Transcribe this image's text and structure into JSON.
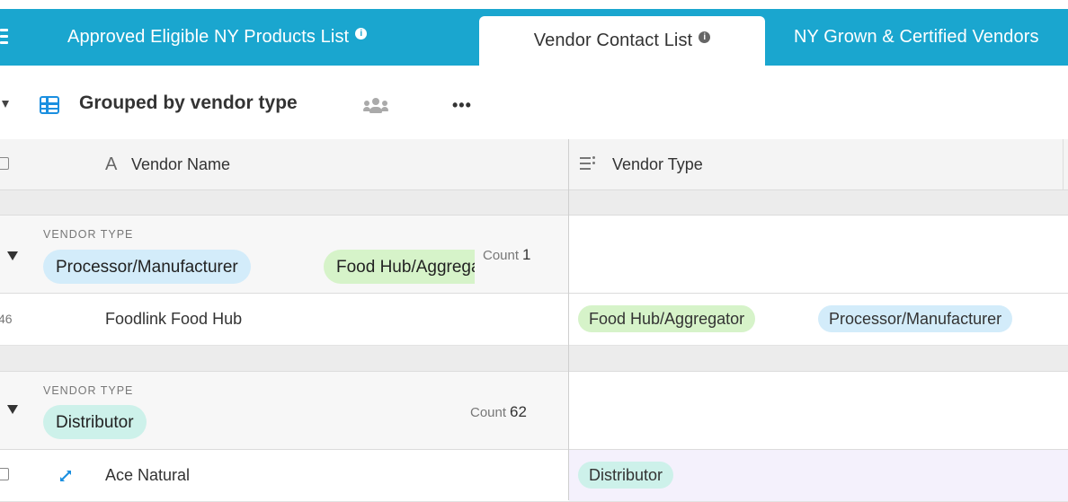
{
  "tabs": [
    {
      "label": "Approved Eligible NY Products List",
      "active": false
    },
    {
      "label": "Vendor Contact List",
      "active": true
    },
    {
      "label": "NY Grown & Certified Vendors",
      "active": false
    }
  ],
  "toolbar": {
    "view_name": "Grouped by vendor type",
    "more_label": "•••"
  },
  "columns": {
    "name": {
      "icon": "A",
      "label": "Vendor Name"
    },
    "type": {
      "label": "Vendor Type"
    }
  },
  "groups": [
    {
      "field_label": "VENDOR TYPE",
      "chips": [
        "Processor/Manufacturer",
        "Food Hub/Aggregator"
      ],
      "count_label": "Count",
      "count": "1",
      "rows": [
        {
          "number": "46",
          "name": "Foodlink Food Hub",
          "types": [
            "Food Hub/Aggregator",
            "Processor/Manufacturer"
          ]
        }
      ]
    },
    {
      "field_label": "VENDOR TYPE",
      "chips": [
        "Distributor"
      ],
      "count_label": "Count",
      "count": "62",
      "rows": [
        {
          "number": "",
          "name": "Ace Natural",
          "types": [
            "Distributor"
          ]
        }
      ]
    }
  ],
  "colors": {
    "tabbar": "#1aa6cf",
    "chip_blue": "#d3ecfa",
    "chip_green": "#d6f3c9",
    "chip_teal": "#cdf1ea",
    "accent": "#1a8fe0"
  },
  "icons": {
    "menu": "menu-icon",
    "info": "info-icon",
    "grid_view": "grid-view-icon",
    "people": "people-icon",
    "text_field": "text-field-icon",
    "multi_select": "multi-select-field-icon",
    "expand": "expand-record-icon",
    "collapse": "caret-down-icon"
  }
}
